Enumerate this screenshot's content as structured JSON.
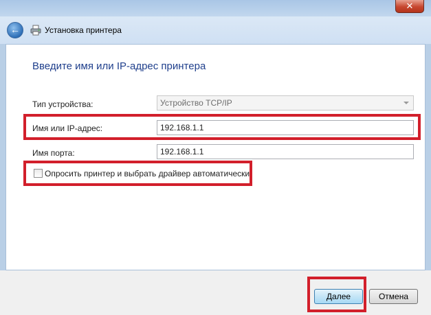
{
  "window": {
    "close_glyph": "✕"
  },
  "nav": {
    "back_glyph": "←",
    "title": "Установка принтера"
  },
  "form": {
    "heading": "Введите имя или IP-адрес принтера",
    "device_type_label": "Тип устройства:",
    "device_type_value": "Устройство TCP/IP",
    "host_label": "Имя или IP-адрес:",
    "host_value": "192.168.1.1",
    "port_label": "Имя порта:",
    "port_value": "192.168.1.1",
    "query_checkbox_label": "Опросить принтер и выбрать драйвер автоматически",
    "query_checked": false
  },
  "buttons": {
    "next": "Далее",
    "cancel": "Отмена"
  },
  "icons": [
    "close-icon",
    "back-arrow-icon",
    "printer-icon",
    "dropdown-arrow-icon",
    "checkbox"
  ],
  "colors": {
    "highlight": "#d21f2b",
    "heading": "#1f3f8c",
    "primary_button_border": "#3c7fb1"
  }
}
